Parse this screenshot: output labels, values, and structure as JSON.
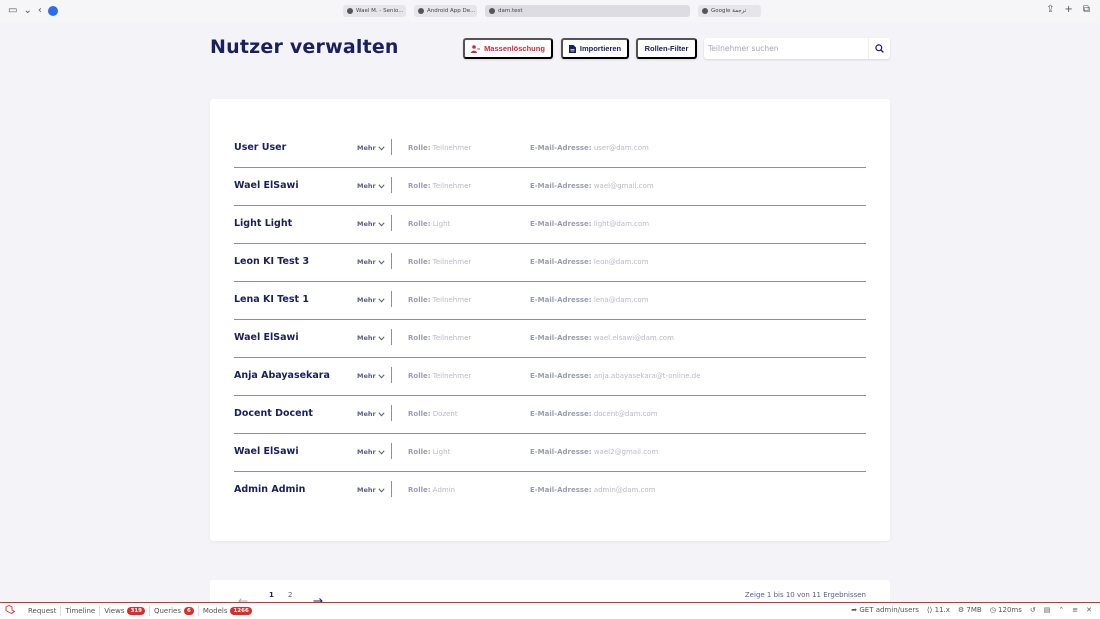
{
  "browser": {
    "tabs": [
      {
        "label": "Wael M. - Senio..."
      },
      {
        "label": "Android App De..."
      },
      {
        "label": "dam.test"
      },
      {
        "label": "Google ترجمة"
      }
    ]
  },
  "header": {
    "title": "Nutzer verwalten",
    "mass_delete_label": "Massenlöschung",
    "import_label": "Importieren",
    "role_filter_label": "Rollen-Filter",
    "search_placeholder": "Teilnehmer suchen"
  },
  "labels": {
    "more": "Mehr",
    "role": "Rolle:",
    "email": "E-Mail-Adresse:"
  },
  "users": [
    {
      "name": "User User",
      "role": "Teilnehmer",
      "email": "user@dam.com"
    },
    {
      "name": "Wael ElSawi",
      "role": "Teilnehmer",
      "email": "wael@gmail.com"
    },
    {
      "name": "Light Light",
      "role": "Light",
      "email": "light@dam.com"
    },
    {
      "name": "Leon KI Test 3",
      "role": "Teilnehmer",
      "email": "leon@dam.com"
    },
    {
      "name": "Lena KI Test 1",
      "role": "Teilnehmer",
      "email": "lena@dam.com"
    },
    {
      "name": "Wael ElSawi",
      "role": "Teilnehmer",
      "email": "wael.elsawi@dam.com"
    },
    {
      "name": "Anja Abayasekara",
      "role": "Teilnehmer",
      "email": "anja.abayasekara@t-online.de"
    },
    {
      "name": "Docent Docent",
      "role": "Dozent",
      "email": "docent@dam.com"
    },
    {
      "name": "Wael ElSawi",
      "role": "Light",
      "email": "wael2@gmail.com"
    },
    {
      "name": "Admin Admin",
      "role": "Admin",
      "email": "admin@dam.com"
    }
  ],
  "pagination": {
    "pages": [
      "1",
      "2"
    ],
    "info": "Zeige 1 bis 10 von 11 Ergebnissen"
  },
  "debugbar": {
    "request": "Request",
    "timeline": "Timeline",
    "views": "Views",
    "views_count": "319",
    "queries": "Queries",
    "queries_count": "6",
    "models": "Models",
    "models_count": "1266",
    "route": "GET admin/users",
    "version": "11.x",
    "memory": "7MB",
    "time": "120ms"
  },
  "colors": {
    "accent": "#1b1f5e",
    "danger": "#d0263a",
    "debug_red": "#e02b2b"
  }
}
